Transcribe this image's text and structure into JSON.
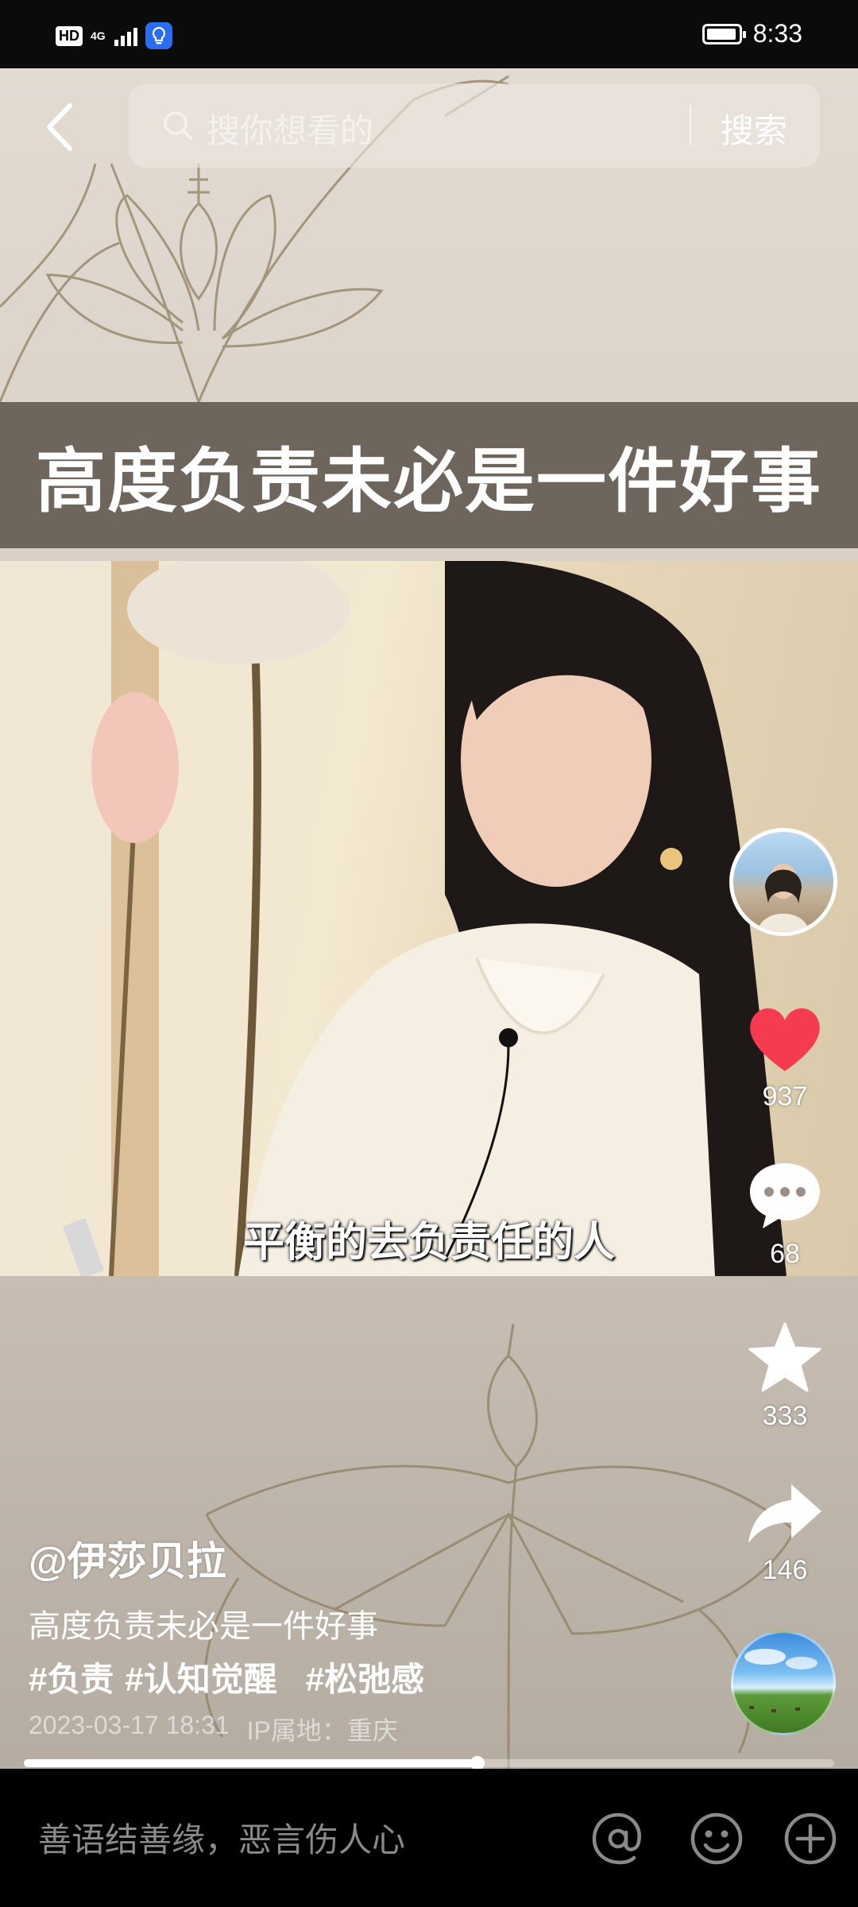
{
  "status_bar": {
    "hd": "HD",
    "network": "4G",
    "time": "8:33"
  },
  "search": {
    "placeholder": "搜你想看的",
    "button": "搜索"
  },
  "video": {
    "title_overlay": "高度负责未必是一件好事",
    "subtitle": "平衡的去负责任的人"
  },
  "actions": {
    "likes": "937",
    "comments": "68",
    "favorites": "333",
    "shares": "146"
  },
  "post": {
    "author": "@伊莎贝拉",
    "description": "高度负责未必是一件好事",
    "tags": [
      "#负责",
      "#认知觉醒",
      "#松弛感"
    ],
    "date": "2023-03-17 18:31",
    "ip_location": "IP属地：重庆",
    "progress": 0.56
  },
  "comment_bar": {
    "placeholder": "善语结善缘，恶言伤人心"
  },
  "colors": {
    "like": "#f43b4f",
    "background": "#000000"
  }
}
